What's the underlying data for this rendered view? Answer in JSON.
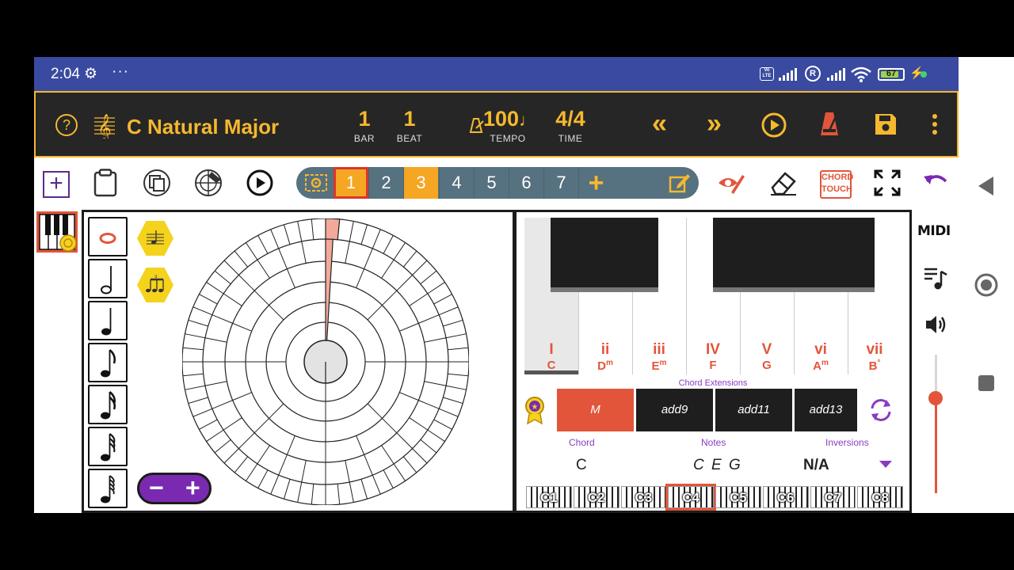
{
  "status": {
    "time": "2:04",
    "gear": "⚙",
    "dots": "···",
    "volte": "Vo LTE",
    "r_mark": "R",
    "battery": "67",
    "bolt": "⚡"
  },
  "header": {
    "help": "?",
    "scale_name": "C Natural Major",
    "bar": {
      "value": "1",
      "label": "BAR"
    },
    "beat": {
      "value": "1",
      "label": "BEAT"
    },
    "tempo": {
      "value": "100",
      "label": "TEMPO"
    },
    "time": {
      "value": "4/4",
      "label": "TIME"
    }
  },
  "tabs": [
    "1",
    "2",
    "3",
    "4",
    "5",
    "6",
    "7"
  ],
  "tab_add": "+",
  "chord_touch": [
    "CHORD",
    "TOUCH"
  ],
  "keyboard": {
    "degrees": [
      {
        "roman": "I",
        "note": "C"
      },
      {
        "roman": "ii",
        "note": "Dm"
      },
      {
        "roman": "iii",
        "note": "Em"
      },
      {
        "roman": "IV",
        "note": "F"
      },
      {
        "roman": "V",
        "note": "G"
      },
      {
        "roman": "vi",
        "note": "Am"
      },
      {
        "roman": "vii",
        "note": "B°"
      }
    ]
  },
  "extensions": {
    "title": "Chord Extensions",
    "items": [
      "M",
      "add9",
      "add11",
      "add13"
    ]
  },
  "labels": {
    "chord": "Chord",
    "notes": "Notes",
    "inversions": "Inversions"
  },
  "values": {
    "chord": "C",
    "notes": "C E G",
    "inversions": "N/A"
  },
  "octaves": [
    "C1",
    "C2",
    "C3",
    "C4",
    "C5",
    "C6",
    "C7",
    "C8"
  ],
  "minus": "−",
  "plus": "+",
  "midi": "MIDI"
}
